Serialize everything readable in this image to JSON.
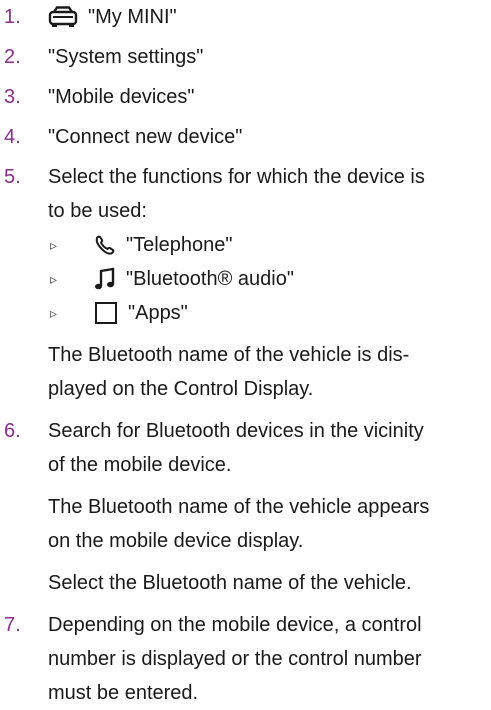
{
  "colors": {
    "step_number": "#8a2d8e",
    "text": "#1a1a1a"
  },
  "steps": [
    {
      "num": "1.",
      "icon": "car-icon",
      "text": "\"My MINI\""
    },
    {
      "num": "2.",
      "text": "\"System settings\""
    },
    {
      "num": "3.",
      "text": "\"Mobile devices\""
    },
    {
      "num": "4.",
      "text": "\"Connect new device\""
    },
    {
      "num": "5.",
      "lines": [
        "Select the functions for which the device is",
        "to be used:"
      ],
      "bullet_glyph": "▹",
      "options": [
        {
          "icon": "telephone-icon",
          "text": "\"Telephone\""
        },
        {
          "icon": "music-note-icon",
          "text": "\"Bluetooth® audio\""
        },
        {
          "icon": "apps-square-icon",
          "text": "\"Apps\""
        }
      ],
      "note_lines": [
        "The Bluetooth name of the vehicle is dis-",
        "played on the Control Display."
      ]
    },
    {
      "num": "6.",
      "lines": [
        "Search for Bluetooth devices in the vicinity",
        "of the mobile device."
      ],
      "note1_lines": [
        "The Bluetooth name of the vehicle appears",
        "on the mobile device display."
      ],
      "note2": "Select the Bluetooth name of the vehicle."
    },
    {
      "num": "7.",
      "lines": [
        "Depending on the mobile device, a control",
        "number is displayed or the control number",
        "must be entered."
      ]
    }
  ]
}
